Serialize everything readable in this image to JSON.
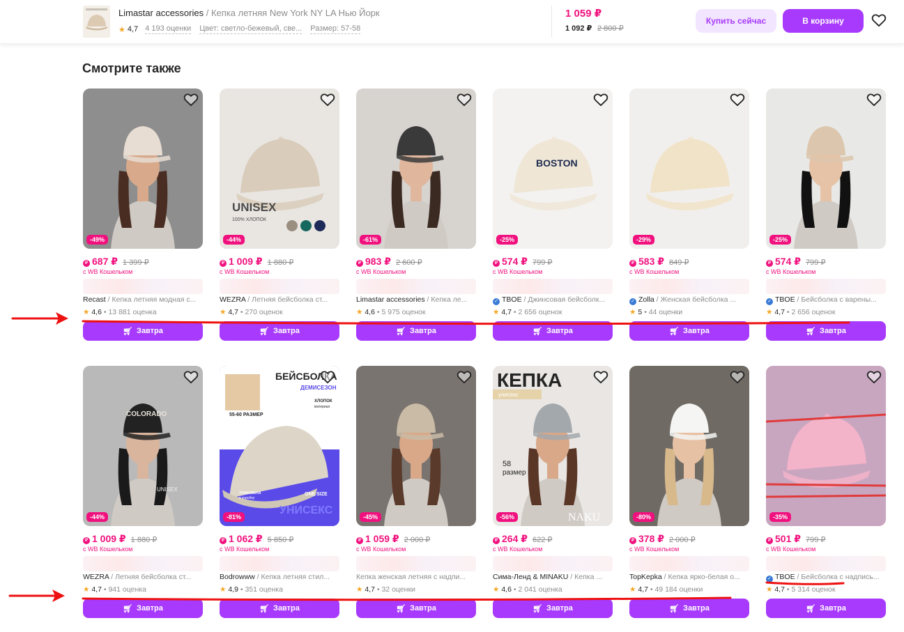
{
  "header": {
    "brand": "Limastar accessories",
    "separator": " / ",
    "product_name": "Кепка летняя New York NY LA Нью Йорк",
    "rating": "4,7",
    "reviews": "4 193 оценки",
    "color": "Цвет: светло-бежевый, све...",
    "size": "Размер: 57-58",
    "price": "1 059 ₽",
    "wallet_price": "1 092 ₽",
    "old_price": "2 800 ₽",
    "buy_now": "Купить сейчас",
    "to_cart": "В корзину"
  },
  "section": {
    "title": "Смотрите также"
  },
  "common": {
    "wallet_label": "с WB Кошельком",
    "tomorrow": "Завтра"
  },
  "products": [
    {
      "discount": "-49%",
      "price": "687 ₽",
      "old": "1 399 ₽",
      "brand": "Recast",
      "name": "Кепка летняя модная с...",
      "verified": false,
      "rating": "4,6",
      "reviews": "13 881 оценка",
      "bg": "#8e8e8e",
      "cap": "#e8ddd2",
      "skin": "#d8a98a",
      "hair": "#4a2d22"
    },
    {
      "discount": "-44%",
      "price": "1 009 ₽",
      "old": "1 880 ₽",
      "brand": "WEZRA",
      "name": "Летняя бейсболка ст...",
      "verified": false,
      "rating": "4,7",
      "reviews": "270 оценок",
      "bg": "#e9e6e2",
      "cap": "#d9ccbb",
      "skin": "",
      "hair": ""
    },
    {
      "discount": "-61%",
      "price": "983 ₽",
      "old": "2 600 ₽",
      "brand": "Limastar accessories",
      "name": "Кепка ле...",
      "verified": false,
      "rating": "4,6",
      "reviews": "5 975 оценок",
      "bg": "#d7d3cf",
      "cap": "#3a3a3a",
      "skin": "#e0b79d",
      "hair": "#3b2a22"
    },
    {
      "discount": "-25%",
      "price": "574 ₽",
      "old": "799 ₽",
      "brand": "TBOE",
      "name": "Джинсовая бейсболк...",
      "verified": true,
      "rating": "4,7",
      "reviews": "2 656 оценок",
      "bg": "#f3f2f0",
      "cap": "#efe6d6",
      "skin": "",
      "hair": ""
    },
    {
      "discount": "-29%",
      "price": "583 ₽",
      "old": "849 ₽",
      "brand": "Zolla",
      "name": "Женская бейсболка ...",
      "verified": true,
      "rating": "5",
      "reviews": "44 оценки",
      "bg": "#f1efed",
      "cap": "#f1e3c8",
      "skin": "",
      "hair": ""
    },
    {
      "discount": "-25%",
      "price": "574 ₽",
      "old": "799 ₽",
      "brand": "TBOE",
      "name": "Бейсболка с варены...",
      "verified": true,
      "rating": "4,7",
      "reviews": "2 656 оценок",
      "bg": "#e8e8e6",
      "cap": "#dcc6ad",
      "skin": "#e6c3a6",
      "hair": "#111111"
    },
    {
      "discount": "-44%",
      "price": "1 009 ₽",
      "old": "1 880 ₽",
      "brand": "WEZRA",
      "name": "Летняя бейсболка ст...",
      "verified": false,
      "rating": "4,7",
      "reviews": "941 оценка",
      "bg": "#b9b9b9",
      "cap": "#222222",
      "skin": "#d9b59e",
      "hair": "#1a1a1a"
    },
    {
      "discount": "-81%",
      "price": "1 062 ₽",
      "old": "5 850 ₽",
      "brand": "Bodrowww",
      "name": "Кепка летняя стил...",
      "verified": false,
      "rating": "4,9",
      "reviews": "351 оценка",
      "bg": "#5a4be8",
      "cap": "#ddd6c8",
      "skin": "",
      "hair": ""
    },
    {
      "discount": "-45%",
      "price": "1 059 ₽",
      "old": "2 000 ₽",
      "brand": "",
      "name": "Кепка женская летняя с надпи...",
      "verified": false,
      "rating": "4,7",
      "reviews": "32 оценки",
      "bg": "#7a7470",
      "cap": "#c9bba6",
      "skin": "#d9a888",
      "hair": "#5a3a2a"
    },
    {
      "discount": "-56%",
      "price": "264 ₽",
      "old": "622 ₽",
      "brand": "Сима-Ленд & MINAKU",
      "name": "Кепка ...",
      "verified": false,
      "rating": "4,6",
      "reviews": "2 041 оценка",
      "bg": "#e9e6e3",
      "cap": "#a3a8ad",
      "skin": "#d8a888",
      "hair": "#5a3626"
    },
    {
      "discount": "-80%",
      "price": "378 ₽",
      "old": "2 000 ₽",
      "brand": "TopKepka",
      "name": "Кепка ярко-белая о...",
      "verified": false,
      "rating": "4,7",
      "reviews": "49 184 оценки",
      "bg": "#6f6a64",
      "cap": "#f5f5f3",
      "skin": "#e7c1a4",
      "hair": "#d8b98c"
    },
    {
      "discount": "-35%",
      "price": "501 ₽",
      "old": "799 ₽",
      "brand": "TBOE",
      "name": "Бейсболка с надпись...",
      "verified": true,
      "rating": "4,7",
      "reviews": "5 314 оценок",
      "bg": "#c9a6c0",
      "cap": "#f3b3c9",
      "skin": "",
      "hair": ""
    }
  ],
  "image_texts": {
    "card2_main": "UNISEX",
    "card2_sub": "100% ХЛОПОК",
    "card7_hat": "COLORADO",
    "card7_shirt": "UNISEX",
    "card8_top": "БЕЙСБОЛКА",
    "card8_sub": "ДЕМИСЕЗОН",
    "card8_size": "55-60 РАЗМЕР",
    "card8_cotton": "ХЛОПОК",
    "card8_material": "материал",
    "card8_pack": "УПАКОВАНА",
    "card8_box": "в коробку",
    "card8_onesize": "ONE SIZE",
    "card8_unisex": "УНИСЕКС",
    "card10_title": "КЕПКА",
    "card10_sub": "унисекс",
    "card10_size_num": "58",
    "card10_size": "размер",
    "card10_logo": "NAKU",
    "card4_hat": "BOSTON"
  },
  "colors": {
    "accent": "#a73afd",
    "accent_light": "#f2e5ff",
    "price": "#f1117e",
    "star": "#f5a623",
    "annotation": "#ee1111"
  }
}
